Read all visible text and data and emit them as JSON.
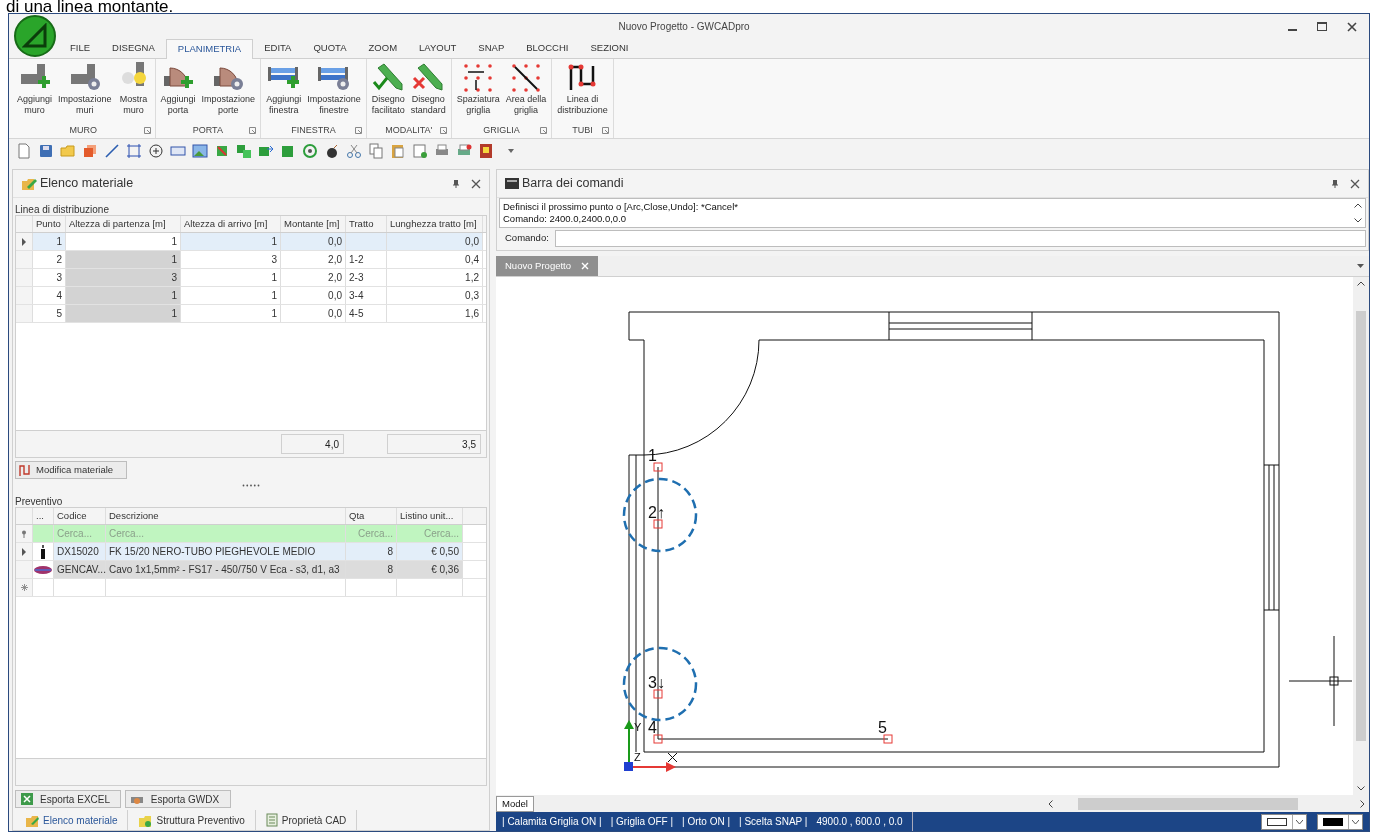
{
  "caption": "di una linea montante.",
  "window": {
    "title": "Nuovo Progetto - GWCADpro"
  },
  "menu_tabs": [
    {
      "label": "FILE",
      "selected": false
    },
    {
      "label": "DISEGNA",
      "selected": false
    },
    {
      "label": "PLANIMETRIA",
      "selected": true
    },
    {
      "label": "EDITA",
      "selected": false
    },
    {
      "label": "QUOTA",
      "selected": false
    },
    {
      "label": "ZOOM",
      "selected": false
    },
    {
      "label": "LAYOUT",
      "selected": false
    },
    {
      "label": "SNAP",
      "selected": false
    },
    {
      "label": "BLOCCHI",
      "selected": false
    },
    {
      "label": "SEZIONI",
      "selected": false
    }
  ],
  "ribbon": [
    {
      "group": "MURO",
      "buttons": [
        {
          "label": "Aggiungi\nmuro",
          "kind": "wall-add"
        },
        {
          "label": "Impostazione\nmuri",
          "kind": "wall-settings"
        },
        {
          "label": "Mostra\nmuro",
          "kind": "wall-show"
        }
      ]
    },
    {
      "group": "PORTA",
      "buttons": [
        {
          "label": "Aggiungi\nporta",
          "kind": "door-add"
        },
        {
          "label": "Impostazione\nporte",
          "kind": "door-settings"
        }
      ]
    },
    {
      "group": "FINESTRA",
      "buttons": [
        {
          "label": "Aggiungi\nfinestra",
          "kind": "window-add"
        },
        {
          "label": "Impostazione\nfinestre",
          "kind": "window-settings"
        }
      ]
    },
    {
      "group": "MODALITA'",
      "buttons": [
        {
          "label": "Disegno\nfacilitato",
          "kind": "pencil-ok"
        },
        {
          "label": "Disegno\nstandard",
          "kind": "pencil-cancel"
        }
      ]
    },
    {
      "group": "GRIGLIA",
      "buttons": [
        {
          "label": "Spaziatura\ngriglia",
          "kind": "grid-spacing"
        },
        {
          "label": "Area della\ngriglia",
          "kind": "grid-area"
        }
      ]
    },
    {
      "group": "TUBI",
      "buttons": [
        {
          "label": "Linea di\ndistribuzione",
          "kind": "pipe-line"
        }
      ]
    }
  ],
  "elenco": {
    "title": "Elenco materiale",
    "section": "Linea di distribuzione",
    "columns": [
      "Punto",
      "Altezza di partenza [m]",
      "Altezza di arrivo [m]",
      "Montante [m]",
      "Tratto",
      "Lunghezza tratto [m]"
    ],
    "rows": [
      {
        "cells": [
          "1",
          "1",
          "1",
          "0,0",
          "",
          "0,0"
        ],
        "selected": true,
        "start_locked": false
      },
      {
        "cells": [
          "2",
          "1",
          "3",
          "2,0",
          "1-2",
          "0,4"
        ],
        "selected": false,
        "start_locked": true
      },
      {
        "cells": [
          "3",
          "3",
          "1",
          "2,0",
          "2-3",
          "1,2"
        ],
        "selected": false,
        "start_locked": true
      },
      {
        "cells": [
          "4",
          "1",
          "1",
          "0,0",
          "3-4",
          "0,3"
        ],
        "selected": false,
        "start_locked": true
      },
      {
        "cells": [
          "5",
          "1",
          "1",
          "0,0",
          "4-5",
          "1,6"
        ],
        "selected": false,
        "start_locked": true
      }
    ],
    "totals": [
      "4,0",
      "3,5"
    ],
    "edit_button": "Modifica materiale"
  },
  "preventivo": {
    "section": "Preventivo",
    "columns": [
      "...",
      "Codice",
      "Descrizione",
      "Qta",
      "Listino unit..."
    ],
    "filter": [
      {
        "placeholder": "Cerca..."
      },
      {
        "placeholder": "Cerca..."
      },
      {
        "placeholder": "Cerca..."
      },
      {
        "placeholder": "Cerca..."
      }
    ],
    "rows": [
      {
        "kind": "tube",
        "cells": [
          "",
          "DX15020",
          "FK 15/20 NERO-TUBO PIEGHEVOLE MEDIO",
          "8",
          "€ 0,50"
        ],
        "selected": true
      },
      {
        "kind": "cable",
        "cells": [
          "",
          "GENCAV...",
          "Cavo 1x1,5mm² - FS17 - 450/750 V Eca - s3, d1, a3",
          "8",
          "€ 0,36"
        ],
        "selected": false
      }
    ]
  },
  "export_buttons": [
    "Esporta EXCEL",
    "Esporta GWDX"
  ],
  "bottom_tabs": [
    {
      "label": "Elenco materiale",
      "selected": true
    },
    {
      "label": "Struttura Preventivo",
      "selected": false
    },
    {
      "label": "Proprietà CAD",
      "selected": false
    }
  ],
  "command_bar": {
    "title": "Barra dei comandi",
    "log": [
      "Definisci il prossimo punto o [Arc,Close,Undo]: *Cancel*",
      "Comando: 2400.0,2400.0,0.0"
    ],
    "prompt": "Comando:"
  },
  "document_tabs": [
    {
      "label": "Nuovo Progetto",
      "selected": true
    }
  ],
  "canvas": {
    "points": [
      "1",
      "2↑",
      "3↓",
      "4",
      "5"
    ],
    "ucs_labels": [
      "Y",
      "Z"
    ]
  },
  "layout_tabs": [
    {
      "label": "Model",
      "selected": true
    }
  ],
  "status_bar": [
    "| Calamita Griglia ON |",
    "| Griglia OFF |",
    "| Orto ON |",
    "| Scelta SNAP |",
    "4900.0 , 600.0 , 0.0"
  ]
}
